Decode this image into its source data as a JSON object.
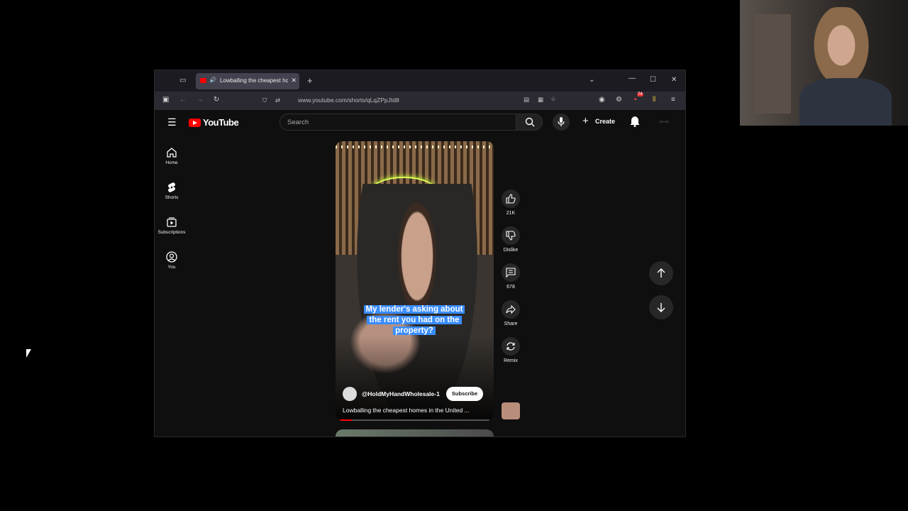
{
  "browser": {
    "tab_title": "Lowballing the cheapest ho",
    "url": "www.youtube.com/shorts/qLqZPpJId8",
    "notification_count": "74"
  },
  "youtube": {
    "logo_text": "YouTube",
    "search_placeholder": "Search",
    "create_label": "Create",
    "sidebar": [
      {
        "label": "Home",
        "icon": "home-icon"
      },
      {
        "label": "Shorts",
        "icon": "shorts-icon"
      },
      {
        "label": "Subscriptions",
        "icon": "subscriptions-icon"
      },
      {
        "label": "You",
        "icon": "you-icon"
      }
    ],
    "video": {
      "caption": "My lender's asking about the rent you had on the property?",
      "channel": "@HoldMyHandWholesale-1",
      "subscribe_label": "Subscribe",
      "title": "Lowballing the cheapest homes in the United ...",
      "progress": 0.08
    },
    "actions": {
      "like_count": "21K",
      "dislike_label": "Dislike",
      "comments_count": "678",
      "share_label": "Share",
      "remix_label": "Remix"
    }
  },
  "colors": {
    "brand_red": "#ff0000",
    "caption_blue": "#3a8dff"
  }
}
